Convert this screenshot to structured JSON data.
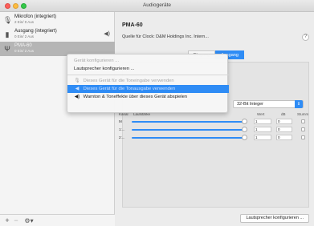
{
  "window": {
    "title": "Audiogeräte"
  },
  "sidebar": {
    "devices": [
      {
        "name": "Mikrofon (integriert)",
        "sub": "2 Ein/ 0 Aus",
        "icon": "microphone-icon",
        "right_icon": ""
      },
      {
        "name": "Ausgang (integriert)",
        "sub": "0 Ein/ 2 Aus",
        "icon": "speaker-icon",
        "right_icon": "speaker-volume-icon"
      },
      {
        "name": "PMA-60",
        "sub": "0 Ein/ 2 Aus",
        "icon": "usb-icon",
        "right_icon": ""
      }
    ],
    "add_label": "+",
    "remove_label": "−",
    "gear_label": "⚙▾"
  },
  "main": {
    "device_title": "PMA-60",
    "clock_source": "Quelle für Clock:  D&M Holdings Inc. Intern...",
    "help_label": "?",
    "tabs": [
      {
        "label": "Eingang"
      },
      {
        "label": "Ausgang"
      }
    ],
    "format_value": "32-Bit Integer",
    "table_headers": {
      "channel": "Kanal",
      "volume": "Lautstärke",
      "value": "Wert",
      "db": "dB",
      "mute": "Stumm"
    },
    "volume_rows": [
      {
        "channel": "M",
        "value": "1",
        "db": "0"
      },
      {
        "channel": "1:...",
        "value": "1",
        "db": "0"
      },
      {
        "channel": "2:...",
        "value": "1",
        "db": "0"
      }
    ],
    "configure_button": "Lautsprecher konfigurieren ..."
  },
  "context_menu": {
    "items": [
      {
        "label": "Gerät konfigurieren ...",
        "state": "disabled",
        "icon": ""
      },
      {
        "label": "Lautsprecher konfigurieren ...",
        "state": "enabled",
        "icon": ""
      },
      {
        "label": "Dieses Gerät für die Toneingabe verwenden",
        "state": "disabled",
        "icon": "microphone-icon"
      },
      {
        "label": "Dieses Gerät für die Tonausgabe verwenden",
        "state": "highlighted",
        "icon": "speaker-icon"
      },
      {
        "label": "Warnton & Toneffekte über dieses Gerät abspielen",
        "state": "enabled",
        "icon": "alert-speaker-icon"
      }
    ]
  },
  "colors": {
    "accent": "#2f8cf5",
    "selection_gray": "#b5b5b5"
  }
}
